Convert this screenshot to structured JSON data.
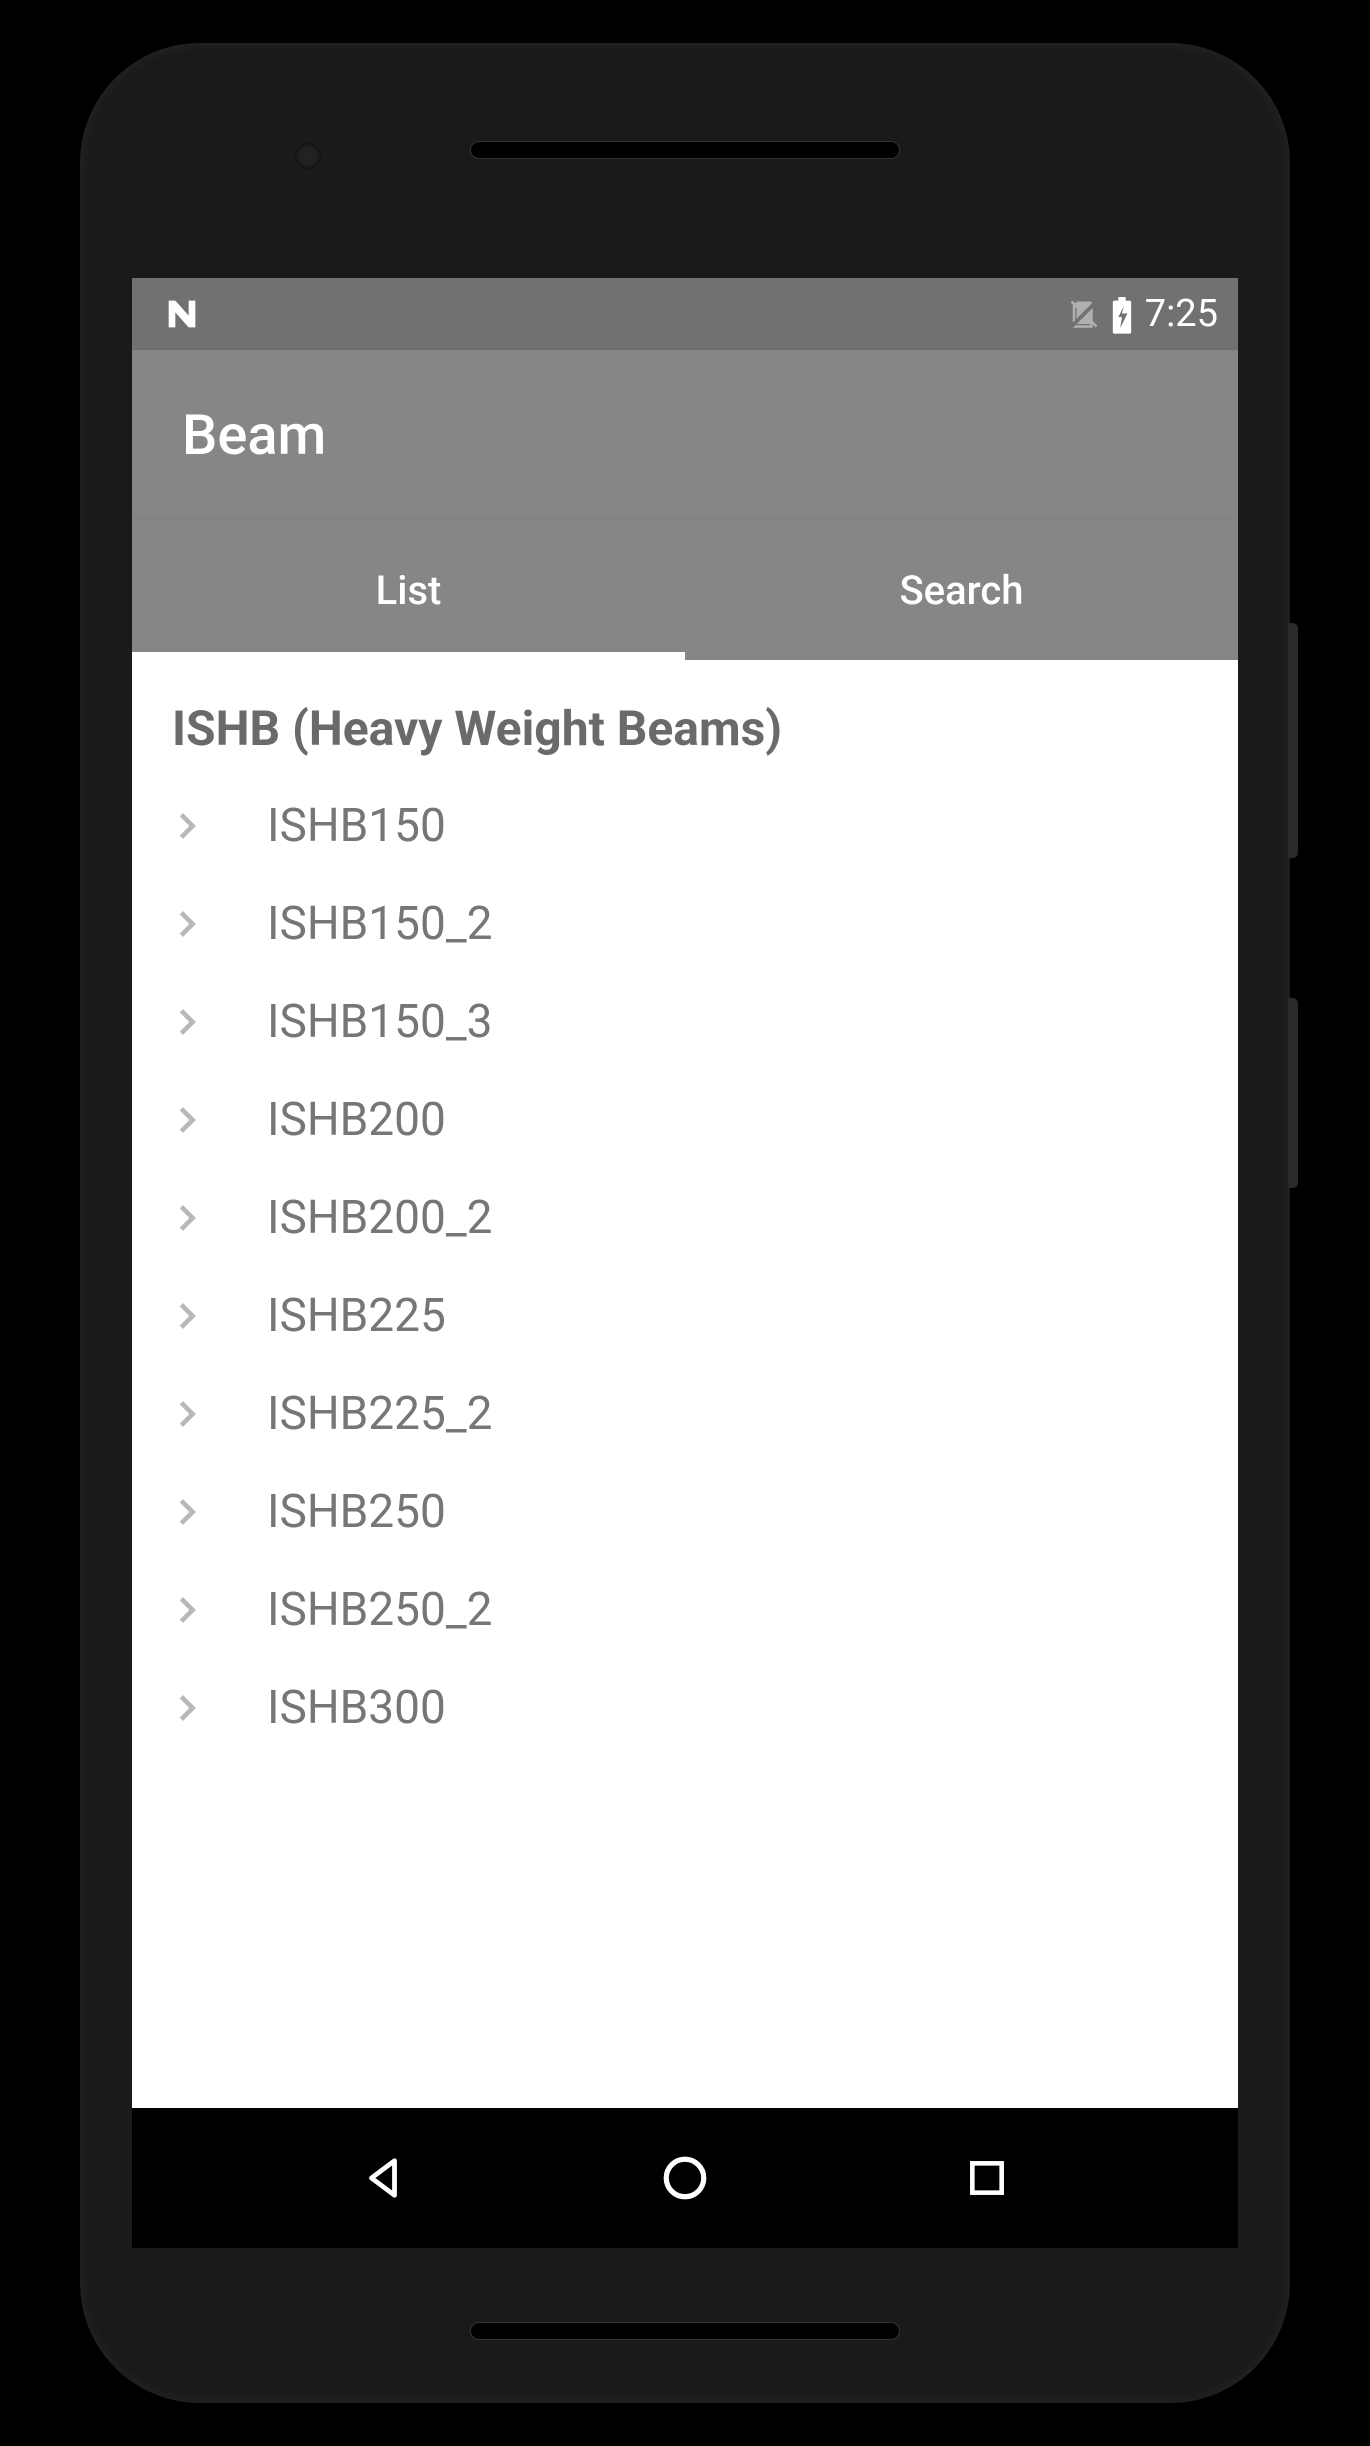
{
  "statusBar": {
    "time": "7:25"
  },
  "appBar": {
    "title": "Beam"
  },
  "tabs": [
    {
      "label": "List",
      "active": true
    },
    {
      "label": "Search",
      "active": false
    }
  ],
  "section": {
    "header": "ISHB  (Heavy Weight Beams)",
    "items": [
      "ISHB150",
      "ISHB150_2",
      "ISHB150_3",
      "ISHB200",
      "ISHB200_2",
      "ISHB225",
      "ISHB225_2",
      "ISHB250",
      "ISHB250_2",
      "ISHB300"
    ]
  }
}
